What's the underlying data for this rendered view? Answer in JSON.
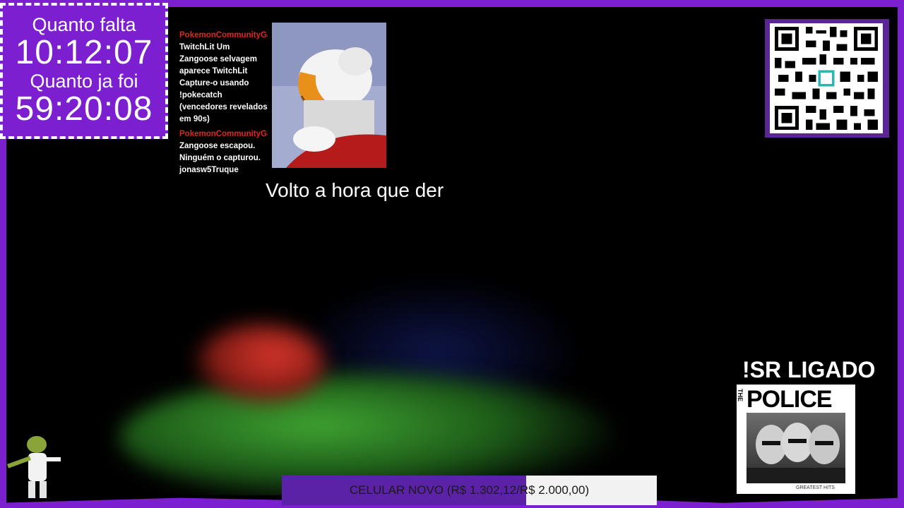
{
  "timer": {
    "remaining_label": "Quanto falta",
    "remaining_value": "10:12:07",
    "elapsed_label": "Quanto ja foi",
    "elapsed_value": "59:20:08"
  },
  "chat": {
    "messages": [
      {
        "user": "PokemonCommunityGame:",
        "text": "TwitchLit Um Zangoose selvagem aparece TwitchLit Capture-o usando !pokecatch (vencedores revelados em 90s)"
      },
      {
        "user": "PokemonCommunityGame:",
        "text": "Zangoose escapou. Ninguém o capturou. jonasw5Truque"
      }
    ]
  },
  "status_text": "Volto a hora que der",
  "song_request": {
    "label": "!SR LIGADO",
    "album_band": "POLICE",
    "album_the": "THE",
    "album_subtitle": "GREATEST HITS"
  },
  "goal": {
    "label": "CELULAR NOVO (R$ 1.302,12/R$ 2.000,00)",
    "progress": 0.651
  },
  "colors": {
    "accent": "#7b1fd0",
    "chat_user": "#e0261f"
  }
}
